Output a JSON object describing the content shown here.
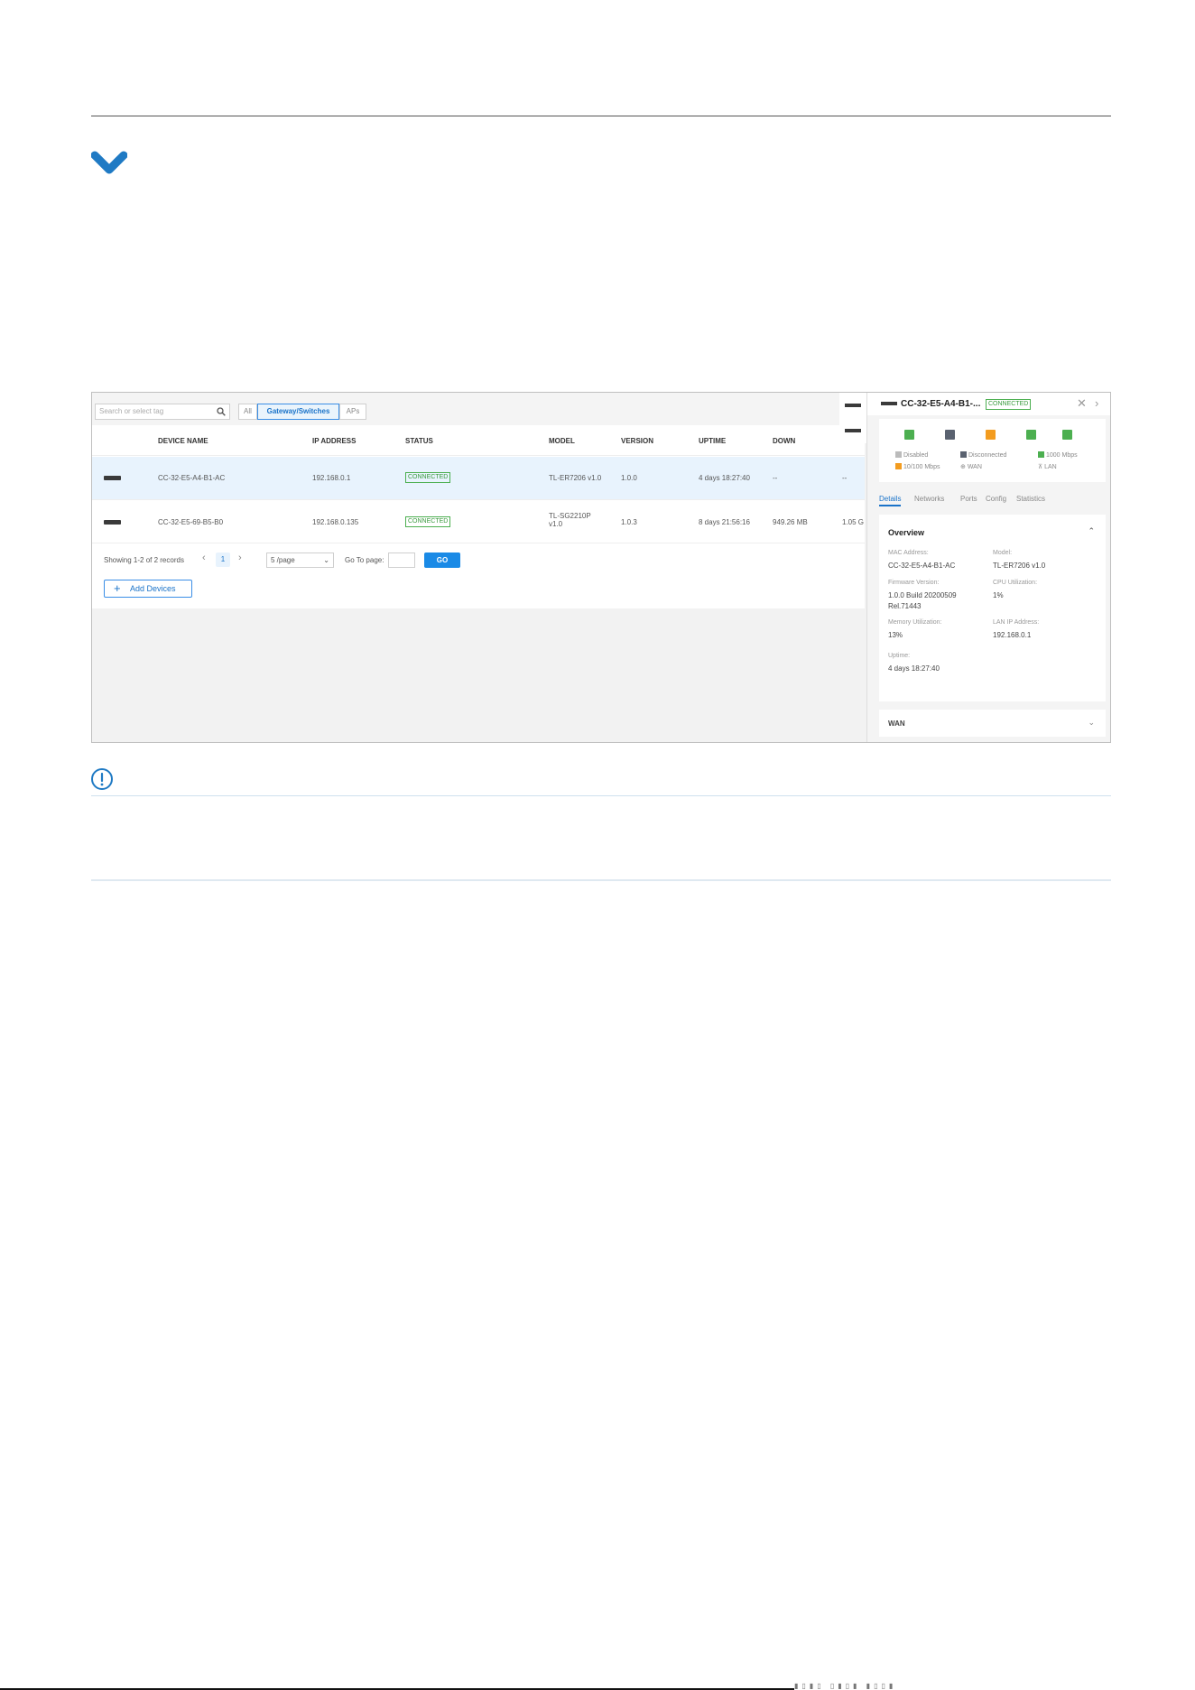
{
  "toolbar": {
    "search_placeholder": "Search or select tag",
    "filters": [
      "All",
      "Gateway/Switches",
      "APs"
    ],
    "active_filter": "Gateway/Switches"
  },
  "table": {
    "columns": [
      "DEVICE NAME",
      "IP ADDRESS",
      "STATUS",
      "MODEL",
      "VERSION",
      "UPTIME",
      "DOWN"
    ],
    "rows": [
      {
        "name": "CC-32-E5-A4-B1-AC",
        "ip": "192.168.0.1",
        "status": "CONNECTED",
        "model": "TL-ER7206 v1.0",
        "model_line2": "",
        "version": "1.0.0",
        "uptime": "4 days 18:27:40",
        "down": "--",
        "up": "--"
      },
      {
        "name": "CC-32-E5-69-B5-B0",
        "ip": "192.168.0.135",
        "status": "CONNECTED",
        "model": "TL-SG2210P",
        "model_line2": "v1.0",
        "version": "1.0.3",
        "uptime": "8 days 21:56:16",
        "down": "949.26 MB",
        "up": "1.05 G"
      }
    ]
  },
  "pager": {
    "summary": "Showing 1-2 of 2 records",
    "current_page": "1",
    "per_page": "5 /page",
    "goto_label": "Go To page:",
    "go_label": "GO"
  },
  "add_devices_label": "Add Devices",
  "panel": {
    "title": "CC-32-E5-A4-B1-...",
    "status": "CONNECTED",
    "ports": [
      {
        "color": "#4caf50",
        "kind": "wan"
      },
      {
        "color": "#5a6270",
        "kind": "disconnected"
      },
      {
        "color": "#f39c1f",
        "kind": "10/100"
      },
      {
        "color": "#4caf50",
        "kind": "lan"
      },
      {
        "color": "#4caf50",
        "kind": "lan"
      }
    ],
    "legend": {
      "disabled": "Disabled",
      "disconnected": "Disconnected",
      "mbps1000": "1000 Mbps",
      "mbps10_100": "10/100 Mbps",
      "wan": "WAN",
      "lan": "LAN"
    },
    "tabs": [
      "Details",
      "Networks",
      "Ports",
      "Config",
      "Statistics"
    ],
    "active_tab": "Details",
    "overview": {
      "title": "Overview",
      "mac_label": "MAC Address:",
      "mac": "CC-32-E5-A4-B1-AC",
      "model_label": "Model:",
      "model": "TL-ER7206 v1.0",
      "firmware_label": "Firmware Version:",
      "firmware_line1": "1.0.0 Build 20200509",
      "firmware_line2": "Rel.71443",
      "cpu_label": "CPU Utilization:",
      "cpu": "1%",
      "memory_label": "Memory Utilization:",
      "memory": "13%",
      "lan_ip_label": "LAN IP Address:",
      "lan_ip": "192.168.0.1",
      "uptime_label": "Uptime:",
      "uptime": "4 days 18:27:40"
    },
    "wan_title": "WAN"
  },
  "colors": {
    "accent": "#1a8ae6",
    "connected": "#4caf50",
    "heading_chevron": "#1f7ac4"
  },
  "icons": [
    "chevron-down-icon",
    "search-icon",
    "device-icon",
    "close-icon",
    "chevron-right-icon",
    "info-icon",
    "plus-icon"
  ]
}
